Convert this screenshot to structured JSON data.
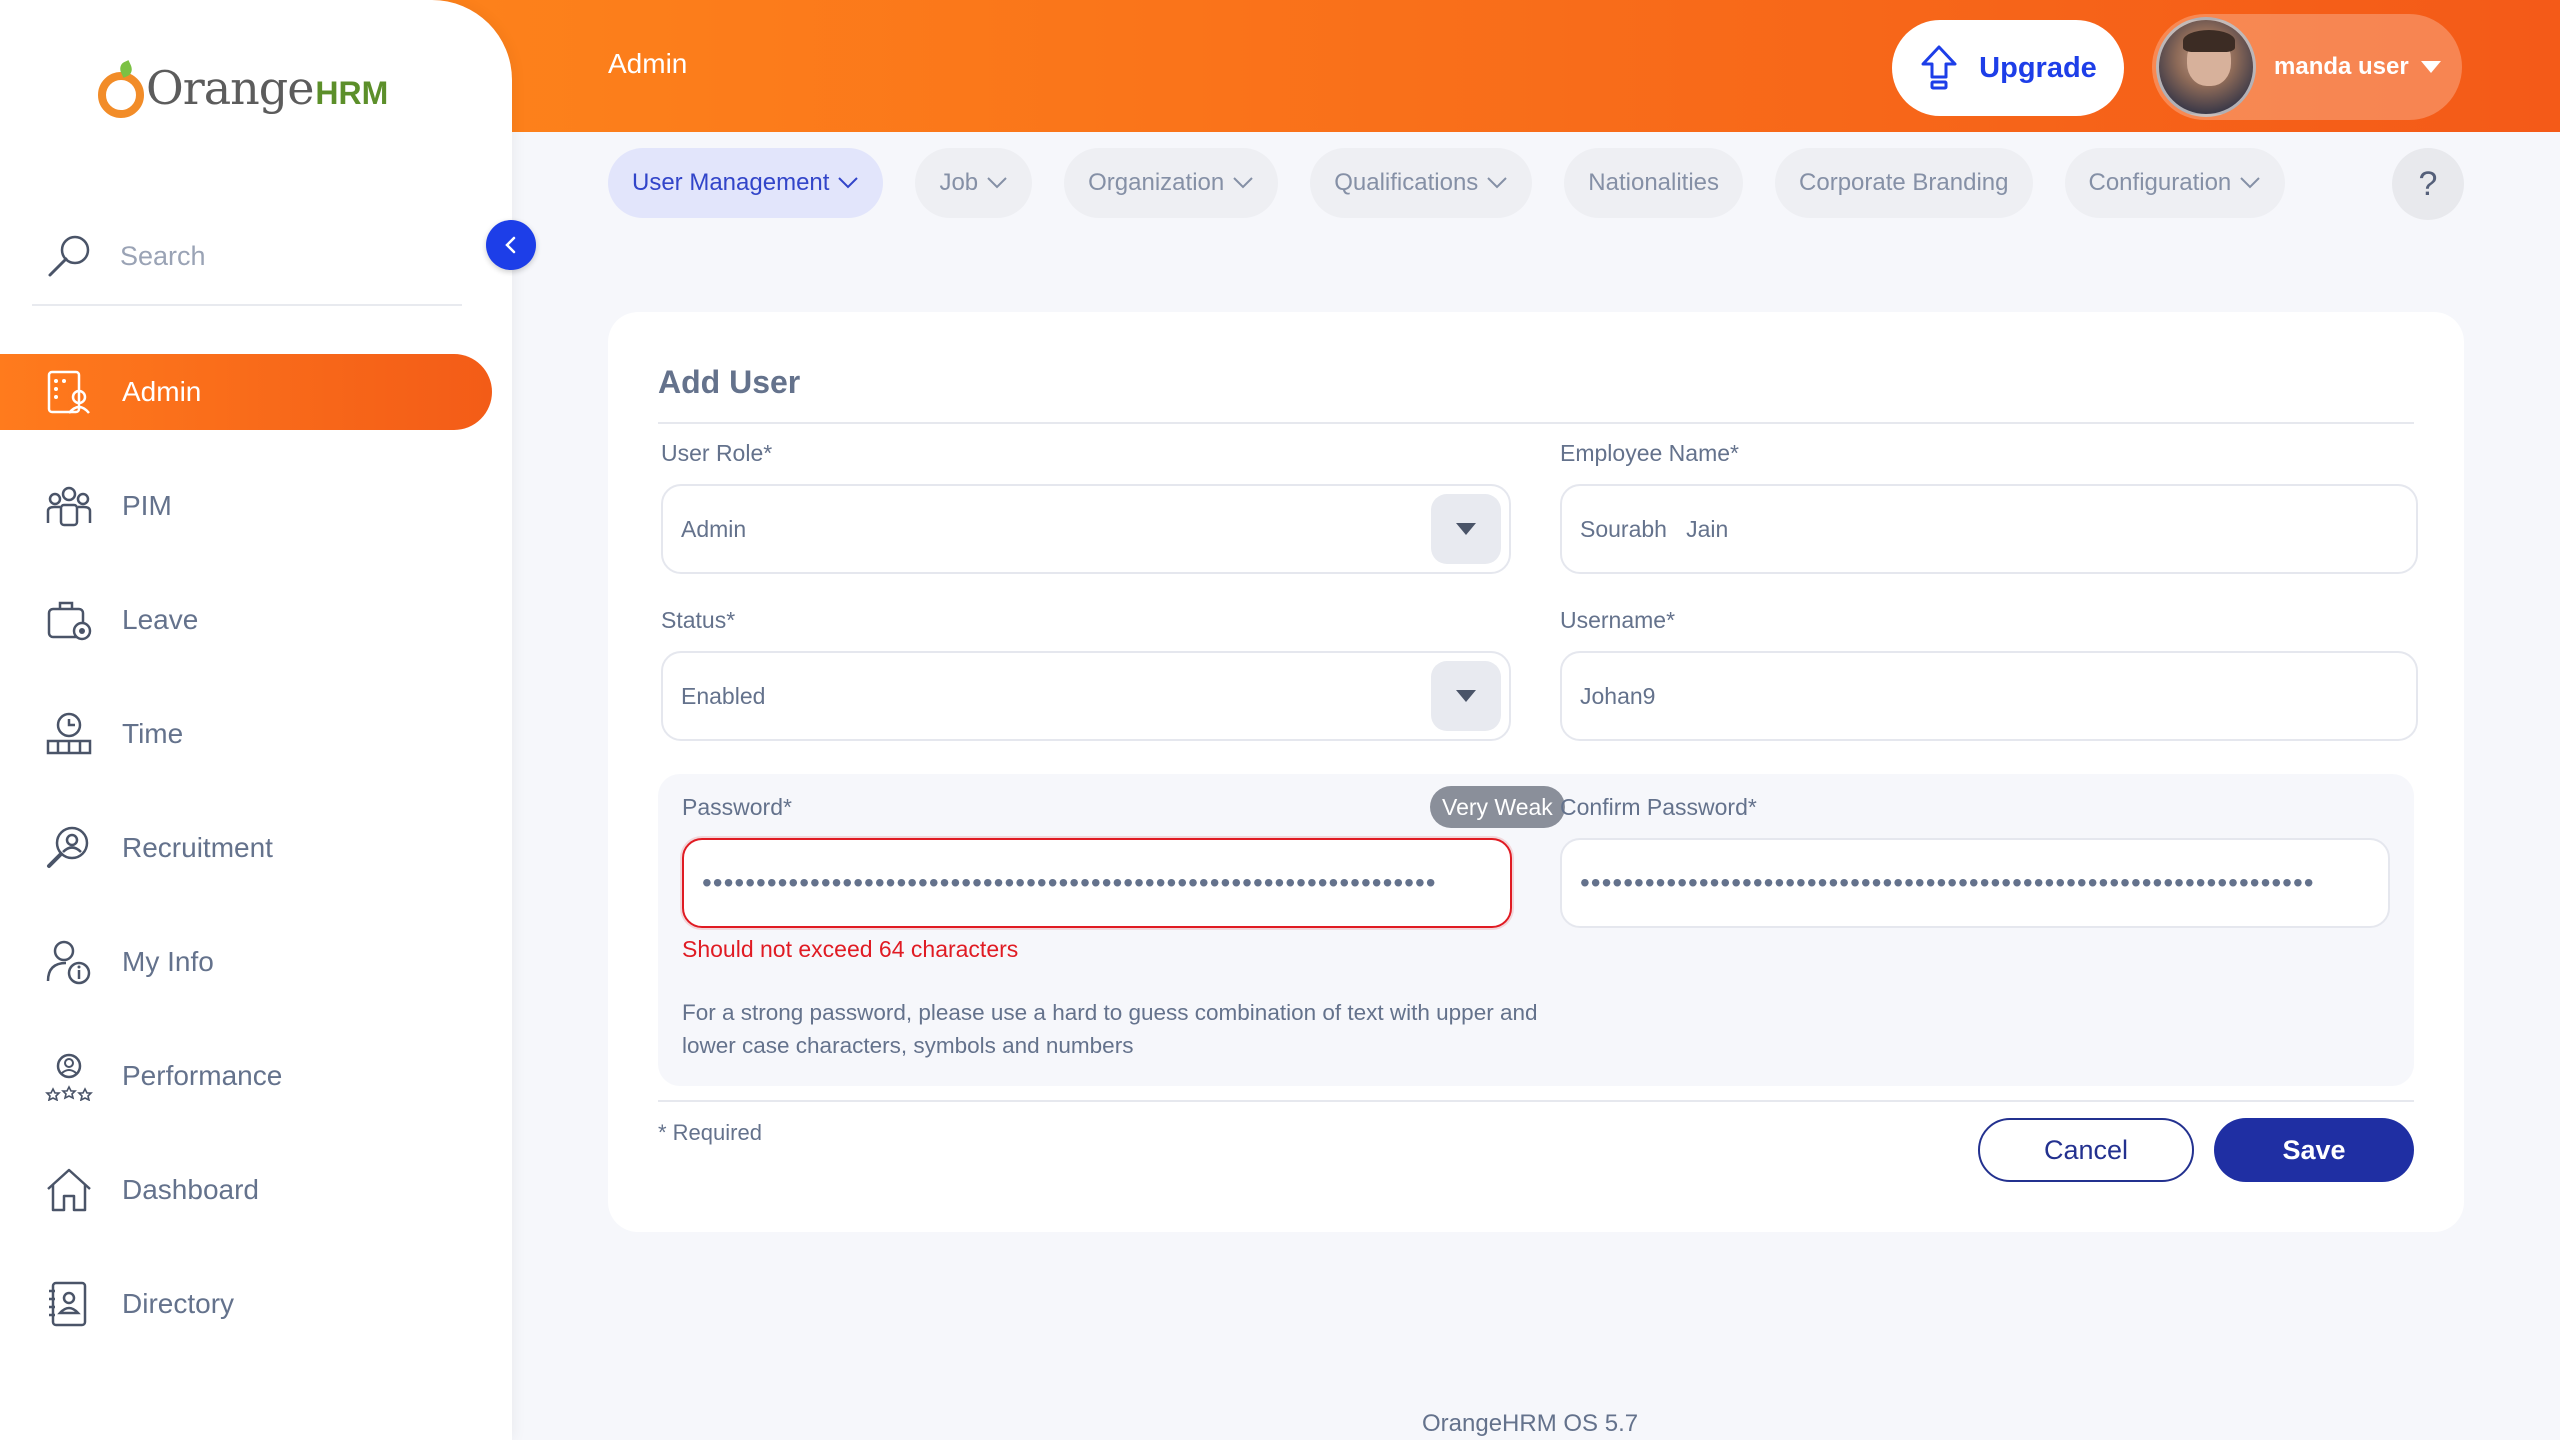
{
  "brand": {
    "logo_main": "Orange",
    "logo_suffix": "HRM"
  },
  "sidebar": {
    "search_placeholder": "Search",
    "items": [
      {
        "label": "Admin",
        "icon": "admin-icon",
        "active": true
      },
      {
        "label": "PIM",
        "icon": "pim-icon"
      },
      {
        "label": "Leave",
        "icon": "leave-icon"
      },
      {
        "label": "Time",
        "icon": "time-icon"
      },
      {
        "label": "Recruitment",
        "icon": "recruitment-icon"
      },
      {
        "label": "My Info",
        "icon": "my-info-icon"
      },
      {
        "label": "Performance",
        "icon": "performance-icon"
      },
      {
        "label": "Dashboard",
        "icon": "dashboard-icon"
      },
      {
        "label": "Directory",
        "icon": "directory-icon"
      }
    ]
  },
  "header": {
    "title": "Admin",
    "upgrade_label": "Upgrade",
    "user_name": "manda user"
  },
  "tabs": [
    {
      "label": "User Management",
      "dropdown": true,
      "active": true
    },
    {
      "label": "Job",
      "dropdown": true
    },
    {
      "label": "Organization",
      "dropdown": true
    },
    {
      "label": "Qualifications",
      "dropdown": true
    },
    {
      "label": "Nationalities",
      "dropdown": false
    },
    {
      "label": "Corporate Branding",
      "dropdown": false
    },
    {
      "label": "Configuration",
      "dropdown": true
    }
  ],
  "help_label": "?",
  "form": {
    "title": "Add User",
    "user_role": {
      "label": "User Role*",
      "value": "Admin"
    },
    "employee_name": {
      "label": "Employee Name*",
      "value": "Sourabh   Jain"
    },
    "status": {
      "label": "Status*",
      "value": "Enabled"
    },
    "username": {
      "label": "Username*",
      "value": "Johan9"
    },
    "password": {
      "label": "Password*",
      "strength": "Very Weak",
      "masked": "••••••••••••••••••••••••••••••••••••••••••••••••••••••••••••••••••••",
      "error": "Should not exceed 64 characters",
      "hint": "For a strong password, please use a hard to guess combination of text with upper and lower case characters, symbols and numbers"
    },
    "confirm_password": {
      "label": "Confirm Password*",
      "masked": "••••••••••••••••••••••••••••••••••••••••••••••••••••••••••••••••••••"
    },
    "required_note": "* Required",
    "cancel_label": "Cancel",
    "save_label": "Save"
  },
  "footer": {
    "version": "OrangeHRM OS 5.7"
  },
  "colors": {
    "accent": "#ff7b1d",
    "primary": "#1d3ee8",
    "error": "#e01b23"
  }
}
